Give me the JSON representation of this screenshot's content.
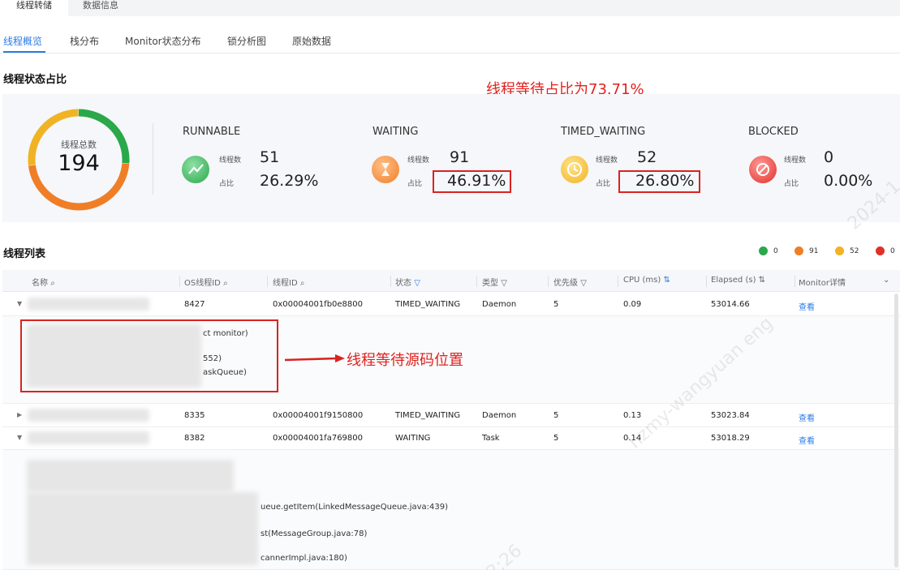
{
  "top_tabs": [
    "线程转储",
    "数据信息"
  ],
  "sub_tabs": [
    "线程概览",
    "栈分布",
    "Monitor状态分布",
    "锁分析图",
    "原始数据"
  ],
  "stats_title": "线程状态占比",
  "annotation_top": "线程等待占比为73.71%",
  "annotation_middle": "线程等待源码位置",
  "total": {
    "label": "线程总数",
    "value": "194"
  },
  "stat_labels": {
    "count": "线程数",
    "ratio": "占比"
  },
  "states": [
    {
      "name": "RUNNABLE",
      "count": "51",
      "percent": "26.29%",
      "color": "#2aa84a"
    },
    {
      "name": "WAITING",
      "count": "91",
      "percent": "46.91%",
      "color": "#f07e26"
    },
    {
      "name": "TIMED_WAITING",
      "count": "52",
      "percent": "26.80%",
      "color": "#f0b323"
    },
    {
      "name": "BLOCKED",
      "count": "0",
      "percent": "0.00%",
      "color": "#e0302a"
    }
  ],
  "list_title": "线程列表",
  "legend": [
    {
      "color": "#2aa84a",
      "value": "0"
    },
    {
      "color": "#f07e26",
      "value": "91"
    },
    {
      "color": "#f0b323",
      "value": "52"
    },
    {
      "color": "#e0302a",
      "value": "0"
    }
  ],
  "columns": [
    "名称",
    "OS线程ID",
    "线程ID",
    "状态",
    "类型",
    "优先级",
    "CPU (ms)",
    "Elapsed (s)",
    "Monitor详情"
  ],
  "rows": [
    {
      "os_id": "8427",
      "thread_id": "0x00004001fb0e8800",
      "state": "TIMED_WAITING",
      "type": "Daemon",
      "priority": "5",
      "cpu": "0.09",
      "elapsed": "53014.66",
      "detail": "查看"
    },
    {
      "os_id": "8335",
      "thread_id": "0x00004001f9150800",
      "state": "TIMED_WAITING",
      "type": "Daemon",
      "priority": "5",
      "cpu": "0.13",
      "elapsed": "53023.84",
      "detail": "查看"
    },
    {
      "os_id": "8382",
      "thread_id": "0x00004001fa769800",
      "state": "WAITING",
      "type": "Task",
      "priority": "5",
      "cpu": "0.14",
      "elapsed": "53018.29",
      "detail": "查看"
    }
  ],
  "expand1_lines": [
    "ct monitor)",
    "552)",
    "askQueue)"
  ],
  "expand2_lines": [
    "ueue.getItem(LinkedMessageQueue.java:439)",
    "st(MessageGroup.java:78)",
    "cannerImpl.java:180)"
  ],
  "watermark": "hzmy-wangyuan eng",
  "watermark2": "2024-1",
  "watermark3": "2:26"
}
